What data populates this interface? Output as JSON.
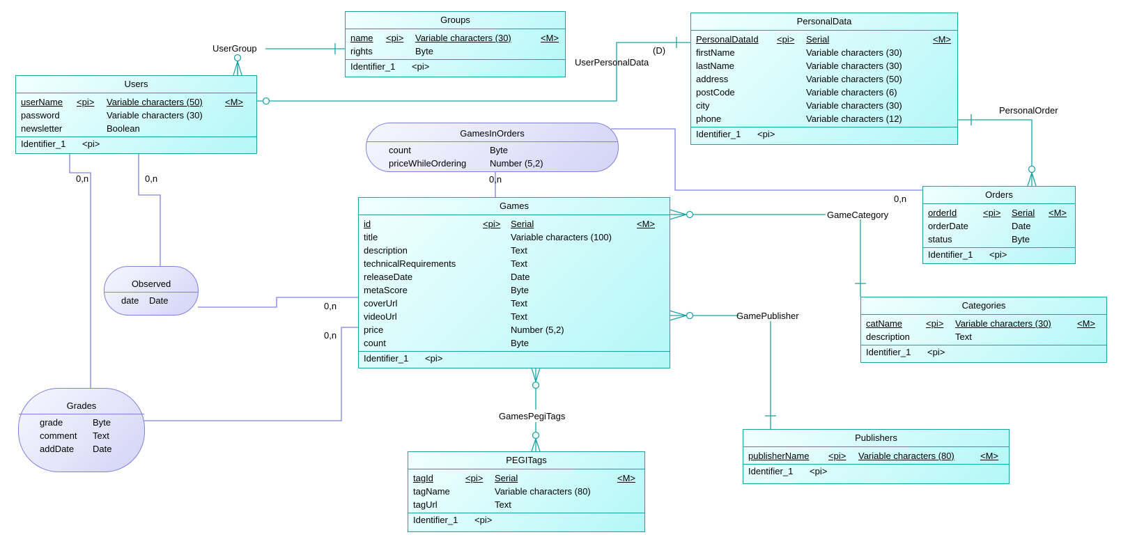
{
  "diagram": {
    "entities": {
      "groups": {
        "title": "Groups",
        "attrs": [
          [
            "name",
            "<pi>",
            "Variable characters (30)",
            "<M>"
          ],
          [
            "rights",
            "",
            "Byte",
            ""
          ]
        ],
        "identifier": [
          "Identifier_1",
          "<pi>"
        ]
      },
      "users": {
        "title": "Users",
        "attrs": [
          [
            "userName",
            "<pi>",
            "Variable characters (50)",
            "<M>"
          ],
          [
            "password",
            "",
            "Variable characters (30)",
            ""
          ],
          [
            "newsletter",
            "",
            "Boolean",
            ""
          ]
        ],
        "identifier": [
          "Identifier_1",
          "<pi>"
        ]
      },
      "personal": {
        "title": "PersonalData",
        "attrs": [
          [
            "PersonalDataId",
            "<pi>",
            "Serial",
            "<M>"
          ],
          [
            "firstName",
            "",
            "Variable characters (30)",
            ""
          ],
          [
            "lastName",
            "",
            "Variable characters (30)",
            ""
          ],
          [
            "address",
            "",
            "Variable characters (50)",
            ""
          ],
          [
            "postCode",
            "",
            "Variable characters (6)",
            ""
          ],
          [
            "city",
            "",
            "Variable characters (30)",
            ""
          ],
          [
            "phone",
            "",
            "Variable characters (12)",
            ""
          ]
        ],
        "identifier": [
          "Identifier_1",
          "<pi>"
        ]
      },
      "orders": {
        "title": "Orders",
        "attrs": [
          [
            "orderId",
            "<pi>",
            "Serial",
            "<M>"
          ],
          [
            "orderDate",
            "",
            "Date",
            ""
          ],
          [
            "status",
            "",
            "Byte",
            ""
          ]
        ],
        "identifier": [
          "Identifier_1",
          "<pi>"
        ]
      },
      "games": {
        "title": "Games",
        "attrs": [
          [
            "id",
            "<pi>",
            "Serial",
            "<M>"
          ],
          [
            "title",
            "",
            "Variable characters (100)",
            ""
          ],
          [
            "description",
            "",
            "Text",
            ""
          ],
          [
            "technicalRequirements",
            "",
            "Text",
            ""
          ],
          [
            "releaseDate",
            "",
            "Date",
            ""
          ],
          [
            "metaScore",
            "",
            "Byte",
            ""
          ],
          [
            "coverUrl",
            "",
            "Text",
            ""
          ],
          [
            "videoUrl",
            "",
            "Text",
            ""
          ],
          [
            "price",
            "",
            "Number (5,2)",
            ""
          ],
          [
            "count",
            "",
            "Byte",
            ""
          ]
        ],
        "identifier": [
          "Identifier_1",
          "<pi>"
        ]
      },
      "categories": {
        "title": "Categories",
        "attrs": [
          [
            "catName",
            "<pi>",
            "Variable characters (30)",
            "<M>"
          ],
          [
            "description",
            "",
            "Text",
            ""
          ]
        ],
        "identifier": [
          "Identifier_1",
          "<pi>"
        ]
      },
      "publishers": {
        "title": "Publishers",
        "attrs": [
          [
            "publisherName",
            "<pi>",
            "Variable characters (80)",
            "<M>"
          ]
        ],
        "identifier": [
          "Identifier_1",
          "<pi>"
        ]
      },
      "pegi": {
        "title": "PEGITags",
        "attrs": [
          [
            "tagId",
            "<pi>",
            "Serial",
            "<M>"
          ],
          [
            "tagName",
            "",
            "Variable characters (80)",
            ""
          ],
          [
            "tagUrl",
            "",
            "Text",
            ""
          ]
        ],
        "identifier": [
          "Identifier_1",
          "<pi>"
        ]
      }
    },
    "associations": {
      "gamesInOrders": {
        "title": "GamesInOrders",
        "attrs": [
          [
            "count",
            "Byte"
          ],
          [
            "priceWhileOrdering",
            "Number (5,2)"
          ]
        ]
      },
      "observed": {
        "title": "Observed",
        "attrs": [
          [
            "date",
            "Date"
          ]
        ]
      },
      "grades": {
        "title": "Grades",
        "attrs": [
          [
            "grade",
            "Byte"
          ],
          [
            "comment",
            "Text"
          ],
          [
            "addDate",
            "Date"
          ]
        ]
      }
    },
    "relationships": {
      "userGroup": "UserGroup",
      "userPersonalData": "UserPersonalData",
      "dependent": "(D)",
      "personalOrder": "PersonalOrder",
      "gameCategory": "GameCategory",
      "gamePublisher": "GamePublisher",
      "gamesPegiTags": "GamesPegiTags"
    },
    "cardinality": "0,n",
    "colors": {
      "entity_border": "#1aa3a3",
      "assoc_border": "#8080e0"
    }
  }
}
